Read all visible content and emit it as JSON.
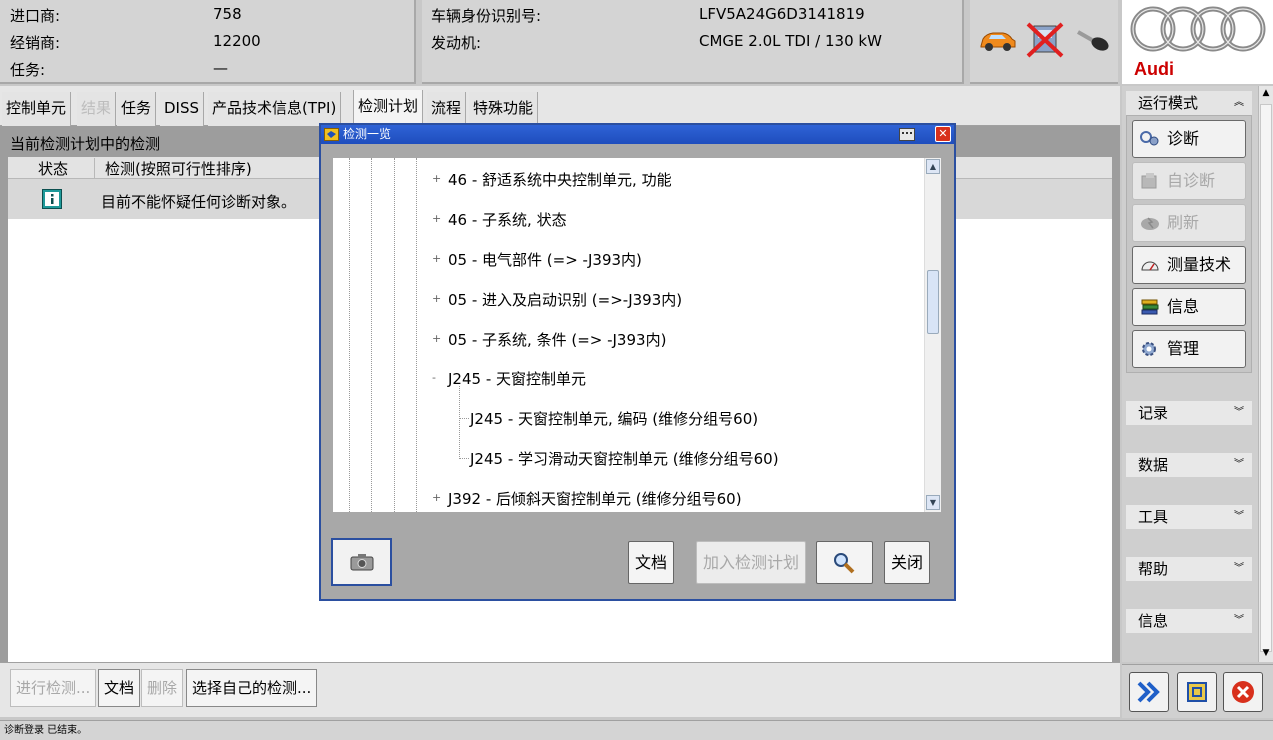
{
  "header": {
    "importer_label": "进口商:",
    "importer_value": "758",
    "dealer_label": "经销商:",
    "dealer_value": "12200",
    "task_label": "任务:",
    "task_value": "—",
    "vin_label": "车辆身份识别号:",
    "vin_value": "LFV5A24G6D3141819",
    "engine_label": "发动机:",
    "engine_value": "CMGE 2.0L TDI / 130 kW",
    "brand": "Audi"
  },
  "tabs": [
    {
      "label": "控制单元",
      "state": "normal"
    },
    {
      "label": "结果",
      "state": "disabled"
    },
    {
      "label": "任务",
      "state": "normal"
    },
    {
      "label": "DISS",
      "state": "normal"
    },
    {
      "label": "产品技术信息(TPI)",
      "state": "normal"
    },
    {
      "label": "检测计划",
      "state": "active"
    },
    {
      "label": "流程",
      "state": "normal"
    },
    {
      "label": "特殊功能",
      "state": "normal"
    }
  ],
  "main": {
    "list_title": "当前检测计划中的检测",
    "col_status": "状态",
    "col_test": "检测(按照可行性排序)",
    "row_text": "目前不能怀疑任何诊断对象。"
  },
  "bottom": {
    "run_test": "进行检测...",
    "document": "文档",
    "delete": "删除",
    "select_own": "选择自己的检测...",
    "status": "诊断登录 已结束。"
  },
  "dialog": {
    "title": "检测一览",
    "tree": [
      {
        "text": "46 - 舒适系统中央控制单元, 功能",
        "level": 1,
        "expander": "+"
      },
      {
        "text": "46 - 子系统, 状态",
        "level": 1,
        "expander": "+"
      },
      {
        "text": "05 - 电气部件 (=> -J393内)",
        "level": 1,
        "expander": "+"
      },
      {
        "text": "05 - 进入及启动识别 (=>-J393内)",
        "level": 1,
        "expander": "+"
      },
      {
        "text": "05 - 子系统, 条件 (=> -J393内)",
        "level": 1,
        "expander": "+"
      },
      {
        "text": "J245 - 天窗控制单元",
        "level": 1,
        "expander": "-"
      },
      {
        "text": "J245 - 天窗控制单元, 编码 (维修分组号60)",
        "level": 2,
        "expander": ""
      },
      {
        "text": "J245 - 学习滑动天窗控制单元 (维修分组号60)",
        "level": 2,
        "expander": ""
      },
      {
        "text": "J392 - 后倾斜天窗控制单元 (维修分组号60)",
        "level": 1,
        "expander": "+"
      }
    ],
    "btn_document": "文档",
    "btn_add_plan": "加入检测计划",
    "btn_close": "关闭"
  },
  "right_panel": {
    "mode_title": "运行模式",
    "buttons": [
      {
        "label": "诊断",
        "enabled": true,
        "icon": "stethoscope-icon"
      },
      {
        "label": "自诊断",
        "enabled": false,
        "icon": "self-diagnosis-icon"
      },
      {
        "label": "刷新",
        "enabled": false,
        "icon": "flash-icon"
      },
      {
        "label": "测量技术",
        "enabled": true,
        "icon": "gauge-icon"
      },
      {
        "label": "信息",
        "enabled": true,
        "icon": "books-icon"
      },
      {
        "label": "管理",
        "enabled": true,
        "icon": "gear-icon"
      }
    ],
    "sections": [
      "记录",
      "数据",
      "工具",
      "帮助",
      "信息"
    ]
  },
  "colors": {
    "title_bar": "#1e4dbd",
    "close_red": "#d8301c",
    "audi_red": "#cc0000"
  }
}
